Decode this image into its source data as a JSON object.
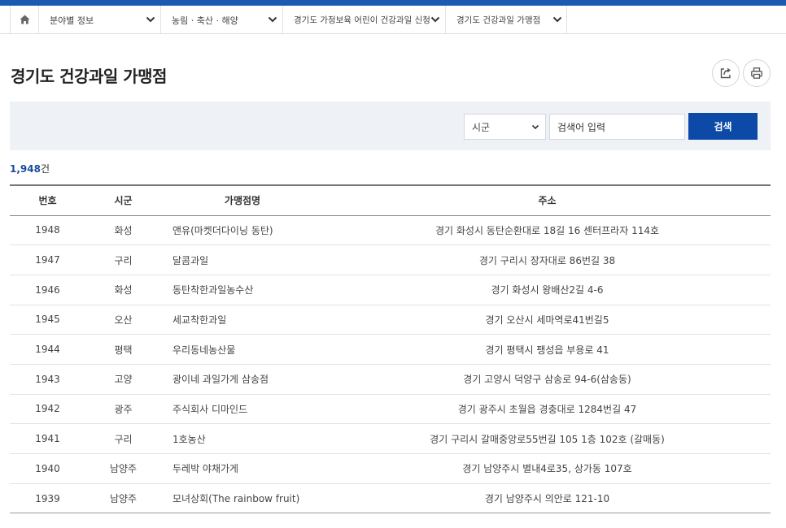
{
  "breadcrumb": {
    "home_icon": "home-icon",
    "items": [
      {
        "label": "분야별 정보"
      },
      {
        "label": "농림 · 축산 · 해양"
      },
      {
        "label": "경기도 가정보육 어린이 건강과일 신청"
      },
      {
        "label": "경기도 건강과일 가맹점"
      }
    ]
  },
  "page": {
    "title": "경기도 건강과일 가맹점",
    "share_icon": "share-icon",
    "print_icon": "print-icon"
  },
  "search": {
    "region_selected": "시군",
    "keyword_value": "검색어 입력",
    "button_label": "검색"
  },
  "result": {
    "count_number": "1,948",
    "count_unit": "건"
  },
  "table": {
    "headers": {
      "no": "번호",
      "region": "시군",
      "name": "가맹점명",
      "address": "주소"
    },
    "rows": [
      {
        "no": "1948",
        "region": "화성",
        "name": "앤유(마켓더다이닝 동탄)",
        "address": "경기 화성시 동탄순환대로 18길 16 센터프라자 114호"
      },
      {
        "no": "1947",
        "region": "구리",
        "name": "달콤과일",
        "address": "경기 구리시 장자대로 86번길 38"
      },
      {
        "no": "1946",
        "region": "화성",
        "name": "동탄착한과일농수산",
        "address": "경기 화성시 왕배산2길 4-6"
      },
      {
        "no": "1945",
        "region": "오산",
        "name": "세교착한과일",
        "address": "경기 오산시 세마역로41번길5"
      },
      {
        "no": "1944",
        "region": "평택",
        "name": "우리동네농산물",
        "address": "경기 평택시 팽성읍 부용로 41"
      },
      {
        "no": "1943",
        "region": "고양",
        "name": "광이네 과일가게 삼송점",
        "address": "경기 고양시 덕양구 삼송로 94-6(삼송동)"
      },
      {
        "no": "1942",
        "region": "광주",
        "name": "주식회사 디마인드",
        "address": "경기 광주시 초월읍 경충대로 1284번길 47"
      },
      {
        "no": "1941",
        "region": "구리",
        "name": "1호농산",
        "address": "경기 구리시 갈매중앙로55번길 105 1층 102호 (갈매동)"
      },
      {
        "no": "1940",
        "region": "남양주",
        "name": "두레박 야채가게",
        "address": "경기 남양주시 별내4로35, 상가동 107호"
      },
      {
        "no": "1939",
        "region": "남양주",
        "name": "모녀상회(The rainbow fruit)",
        "address": "경기 남양주시 의안로 121-10"
      }
    ]
  }
}
